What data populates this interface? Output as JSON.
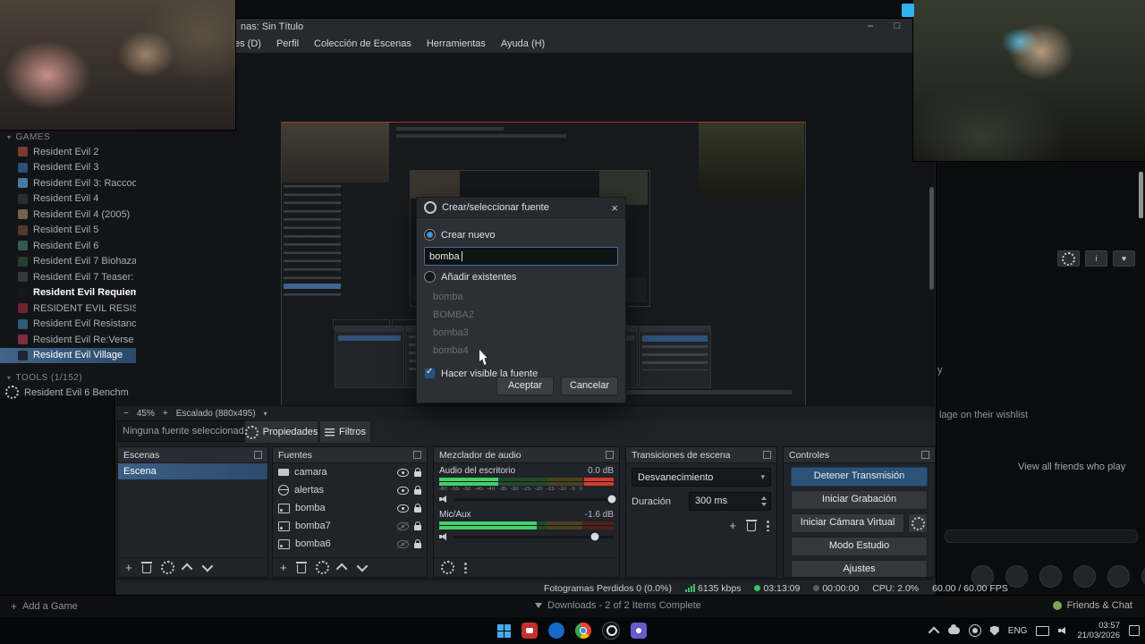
{
  "icons": {
    "caret": "▾",
    "plus": "+",
    "minus": "−",
    "close": "×",
    "info": "i",
    "heart": "♥"
  },
  "steam": {
    "library": {
      "games_header": "GAMES",
      "tools_header": "TOOLS (1/152)",
      "games": [
        {
          "label": "Resident Evil 2",
          "icon_color": "#7a3b2e"
        },
        {
          "label": "Resident Evil 3",
          "icon_color": "#2d4f78"
        },
        {
          "label": "Resident Evil 3: Raccoo",
          "icon_color": "#49799f"
        },
        {
          "label": "Resident Evil 4",
          "icon_color": "#2a2d31"
        },
        {
          "label": "Resident Evil 4 (2005)",
          "icon_color": "#6f6547"
        },
        {
          "label": "Resident Evil 5",
          "icon_color": "#503a2b"
        },
        {
          "label": "Resident Evil 6",
          "icon_color": "#355a55"
        },
        {
          "label": "Resident Evil 7 Biohaza",
          "icon_color": "#233d2e"
        },
        {
          "label": "Resident Evil 7 Teaser:",
          "icon_color": "#33383c"
        },
        {
          "label": "Resident Evil Requiem",
          "icon_color": "#15181a",
          "highlight": true
        },
        {
          "label": "RESIDENT EVIL RESISTA",
          "icon_color": "#6e2430"
        },
        {
          "label": "Resident Evil Resistanc",
          "icon_color": "#2e5a74"
        },
        {
          "label": "Resident Evil Re:Verse",
          "icon_color": "#7a2e3a"
        },
        {
          "label": "Resident Evil Village",
          "icon_color": "#1c2836",
          "selected": true
        }
      ],
      "tools": [
        {
          "label": "Resident Evil 6 Benchm"
        }
      ]
    },
    "page": {
      "partial_text": "y",
      "wishlist_text": "lage on their wishlist",
      "friends_text": "View all friends who play"
    },
    "bottom_bar": {
      "add_game": "Add a Game",
      "downloads": "Downloads - 2 of 2 Items Complete",
      "friends_chat": "Friends & Chat"
    }
  },
  "obs": {
    "title": "nas: Sin Título",
    "window": {
      "minimize": "–",
      "maximize": "□"
    },
    "menu": [
      "es (D)",
      "Perfil",
      "Colección de Escenas",
      "Herramientas",
      "Ayuda (H)"
    ],
    "zoom": {
      "value": "45%",
      "scaled": "Escalado (880x495)"
    },
    "source_row": {
      "empty": "Ninguna fuente seleccionad",
      "properties": "Propiedades",
      "filters": "Filtros"
    },
    "dialog": {
      "title": "Crear/seleccionar fuente",
      "radio_new": "Crear nuevo",
      "input_value": "bomba",
      "radio_existing": "Añadir existentes",
      "existing": [
        "bomba",
        "BOMBA2",
        "bomba3",
        "bomba4"
      ],
      "make_visible": "Hacer visible la fuente",
      "accept": "Aceptar",
      "cancel": "Cancelar"
    },
    "scenes": {
      "title": "Escenas",
      "items": [
        {
          "label": "Escena",
          "selected": true
        }
      ]
    },
    "sources": {
      "title": "Fuentes",
      "items": [
        {
          "label": "camara",
          "type": "camera",
          "visible": true
        },
        {
          "label": "alertas",
          "type": "browser",
          "visible": true
        },
        {
          "label": "bomba",
          "type": "image",
          "visible": true
        },
        {
          "label": "bomba7",
          "type": "image",
          "visible": false
        },
        {
          "label": "bomba6",
          "type": "image",
          "visible": false
        }
      ]
    },
    "mixer": {
      "title": "Mezclador de audio",
      "scale": "-60 -55 -50 -45 -40 -35 -30 -25 -20 -15 -10 -5 0",
      "tracks": [
        {
          "name": "Audio del escritorio",
          "db": "0.0 dB",
          "level": 34,
          "slider": 99,
          "clip": true
        },
        {
          "name": "Mic/Aux",
          "db": "-1.6 dB",
          "level": 56,
          "slider": 88,
          "clip": false
        }
      ]
    },
    "transitions": {
      "title": "Transiciones de escena",
      "selected": "Desvanecimiento",
      "duration_label": "Duración",
      "duration_value": "300 ms"
    },
    "controls": {
      "title": "Controles",
      "stop_stream": "Detener Transmisión",
      "start_record": "Iniciar Grabación",
      "virtual_cam": "Iniciar Cámara Virtual",
      "studio_mode": "Modo Estudio",
      "settings": "Ajustes"
    },
    "status": {
      "dropped": "Fotogramas Perdidos 0 (0.0%)",
      "bitrate": "6135 kbps",
      "stream_time": "03:13:09",
      "rec_time": "00:00:00",
      "cpu": "CPU: 2.0%",
      "fps": "60.00 / 60.00 FPS"
    }
  },
  "taskbar": {
    "lang": "ENG",
    "time": "03:57",
    "date": "21/03/2026"
  }
}
